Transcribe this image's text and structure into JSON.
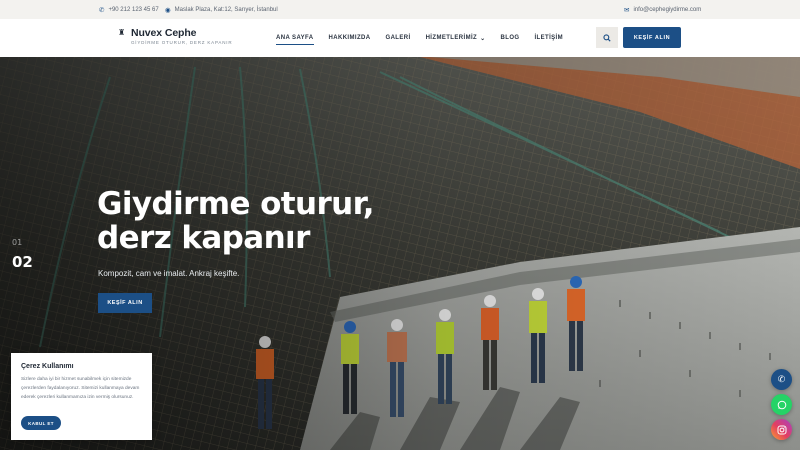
{
  "topbar": {
    "phone": "+90 212 123 45 67",
    "address": "Maslak Plaza, Kat:12, Sarıyer, İstanbul",
    "email": "info@cephegiydirme.com",
    "phone_icon": "phone-icon",
    "address_icon": "map-pin-icon",
    "email_icon": "envelope-icon"
  },
  "header": {
    "brand_name": "Nuvex Cephe",
    "brand_tagline": "GİYDİRME OTURUR, DERZ KAPANIR",
    "nav": [
      {
        "label": "ANA SAYFA",
        "active": true
      },
      {
        "label": "HAKKIMIZDA"
      },
      {
        "label": "GALERİ"
      },
      {
        "label": "HİZMETLERİMİZ",
        "dropdown": true
      },
      {
        "label": "BLOG"
      },
      {
        "label": "İLETİŞİM"
      }
    ],
    "search_icon": "search-icon",
    "cta_label": "KEŞİF ALIN"
  },
  "hero": {
    "title_line1": "Giydirme oturur,",
    "title_line2": "derz kapanır",
    "subtitle": "Kompozit, cam ve imalat. Ankraj keşifte.",
    "cta_label": "KEŞİF ALIN",
    "slide_prev": "01",
    "slide_current": "02"
  },
  "cookie": {
    "title": "Çerez Kullanımı",
    "text": "Sizlere daha iyi bir hizmet sunabilmek için sitemizde çerezlerden faydalanıyoruz. Sitemizi kullanmaya devam ederek çerezleri kullanmamıza izin vermiş olursunuz.",
    "button": "KABUL ET"
  },
  "floating": {
    "phone_icon": "phone-icon",
    "whatsapp_icon": "whatsapp-icon",
    "instagram_icon": "instagram-icon"
  },
  "colors": {
    "accent": "#1c4f86",
    "topbar_bg": "#f3f2ef",
    "whatsapp": "#25d366"
  }
}
